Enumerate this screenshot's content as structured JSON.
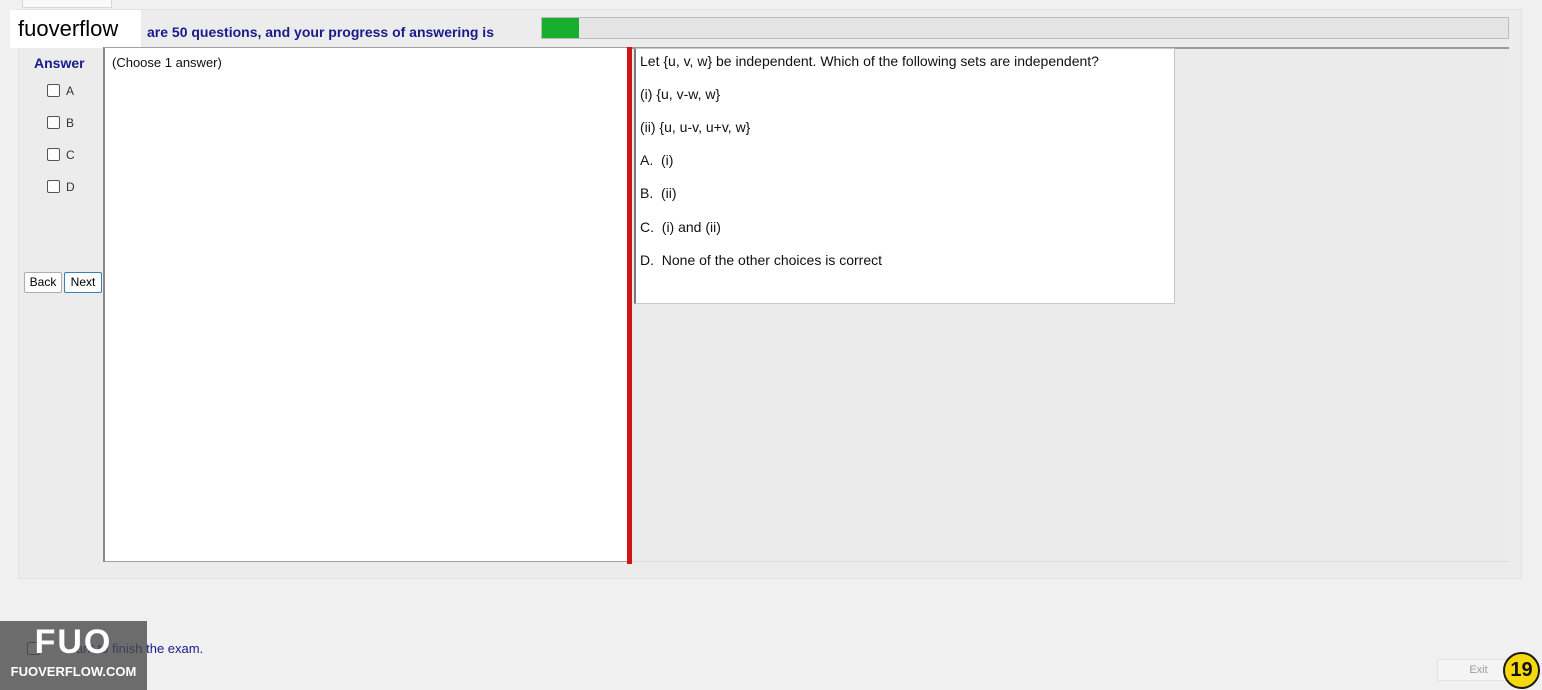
{
  "header": {
    "brand": "fuoverflow",
    "progress_text": "are 50 questions, and your progress of answering is",
    "progress_fraction": 0.038
  },
  "answer_panel": {
    "title": "Answer",
    "options": [
      "A",
      "B",
      "C",
      "D"
    ],
    "choose_hint": "(Choose 1 answer)",
    "back_label": "Back",
    "next_label": "Next"
  },
  "question": {
    "lines": [
      "Let {u, v, w} be independent. Which of the following sets are independent?",
      "(i) {u, v-w, w}",
      "(ii) {u, u-v, u+v, w}",
      "A.  (i)",
      "B.  (ii)",
      "C.  (i) and (ii)",
      "D.  None of the other choices is correct"
    ]
  },
  "footer": {
    "finish_text": "ant to finish the exam.",
    "logo_big": "FUO",
    "logo_small": "FUOVERFLOW.COM",
    "exit_label": "Exit",
    "page_number": "19"
  },
  "colors": {
    "progress_fill": "#16b02e",
    "splitter": "#d1141a",
    "heading_text": "#1a1a8c",
    "badge": "#f5d90c"
  }
}
